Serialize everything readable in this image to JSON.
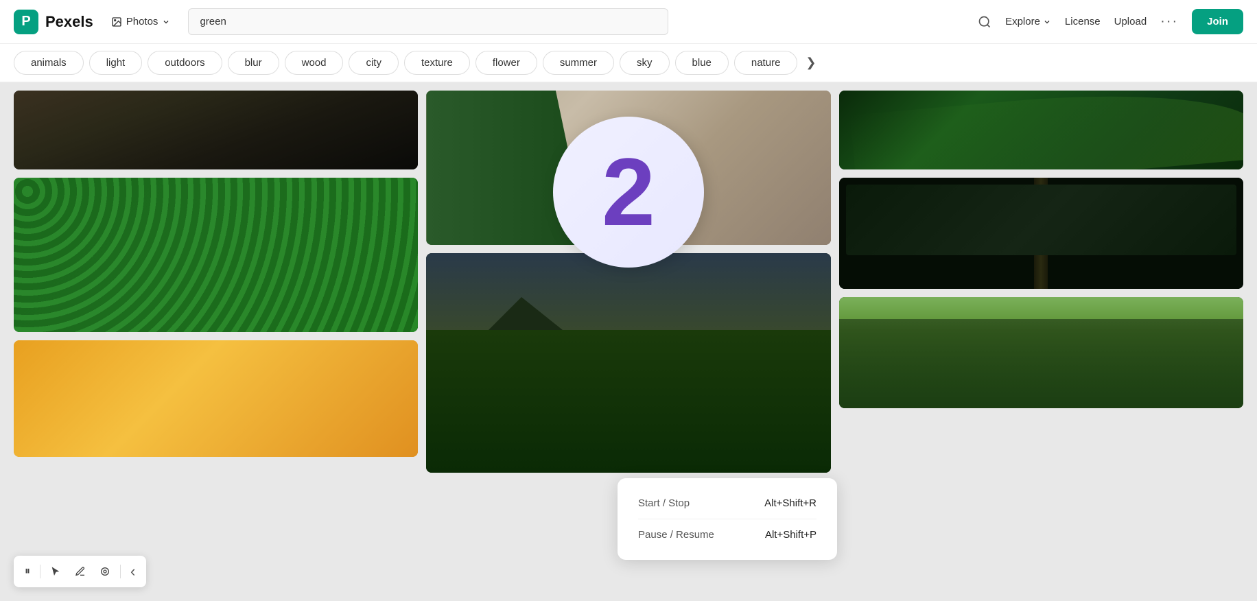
{
  "header": {
    "logo_text": "Pexels",
    "photos_label": "Photos",
    "search_value": "green",
    "explore_label": "Explore",
    "license_label": "License",
    "upload_label": "Upload",
    "more_label": "···",
    "join_label": "Join"
  },
  "tags": {
    "items": [
      "animals",
      "light",
      "outdoors",
      "blur",
      "wood",
      "city",
      "texture",
      "flower",
      "summer",
      "sky",
      "blue",
      "nature"
    ],
    "next_icon": "❯"
  },
  "overlay": {
    "number": "2",
    "shortcut_title1": "Start / Stop",
    "shortcut_key1": "Alt+Shift+R",
    "shortcut_title2": "Pause / Resume",
    "shortcut_key2": "Alt+Shift+P"
  },
  "toolbar": {
    "pause_icon": "⏸",
    "arrow_icon": "➤",
    "pen_icon": "✏",
    "eraser_icon": "◎",
    "back_icon": "‹"
  }
}
